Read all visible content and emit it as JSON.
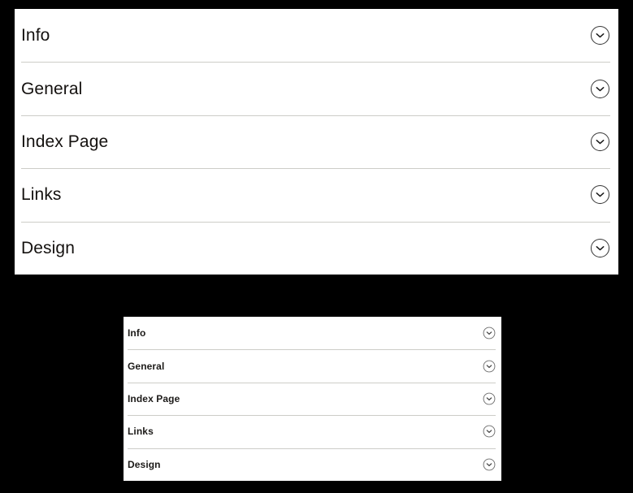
{
  "background_color": "#000000",
  "panels": [
    {
      "name": "large-accordion",
      "variant": "large",
      "panel_background": "#ffffff",
      "divider_color": "#cdcdc8",
      "text_color": "#14110f",
      "rows": [
        {
          "label": "Info",
          "toggle_icon": "chevron-down-circle-icon",
          "expanded": false
        },
        {
          "label": "General",
          "toggle_icon": "chevron-down-circle-icon",
          "expanded": false
        },
        {
          "label": "Index Page",
          "toggle_icon": "chevron-down-circle-icon",
          "expanded": false
        },
        {
          "label": "Links",
          "toggle_icon": "chevron-down-circle-icon",
          "expanded": false
        },
        {
          "label": "Design",
          "toggle_icon": "chevron-down-circle-icon",
          "expanded": false
        }
      ]
    },
    {
      "name": "small-accordion",
      "variant": "small",
      "panel_background": "#ffffff",
      "divider_color": "#cdcdc8",
      "text_color": "#1c1a18",
      "rows": [
        {
          "label": "Info",
          "toggle_icon": "chevron-down-circle-icon",
          "expanded": false
        },
        {
          "label": "General",
          "toggle_icon": "chevron-down-circle-icon",
          "expanded": false
        },
        {
          "label": "Index Page",
          "toggle_icon": "chevron-down-circle-icon",
          "expanded": false
        },
        {
          "label": "Links",
          "toggle_icon": "chevron-down-circle-icon",
          "expanded": false
        },
        {
          "label": "Design",
          "toggle_icon": "chevron-down-circle-icon",
          "expanded": false
        }
      ]
    }
  ]
}
